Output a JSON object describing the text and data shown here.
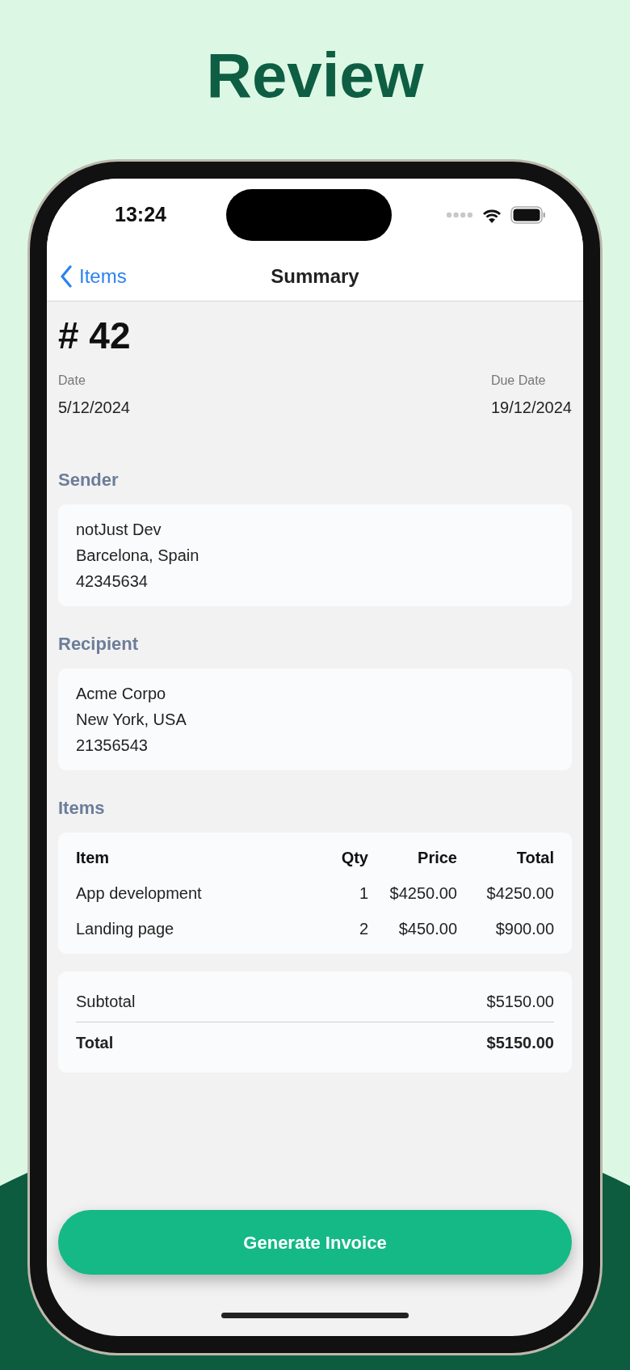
{
  "app_title": "Review",
  "status_bar": {
    "time": "13:24"
  },
  "nav": {
    "back": "Items",
    "title": "Summary"
  },
  "invoice": {
    "number": "# 42",
    "date_label": "Date",
    "date": "5/12/2024",
    "due_label": "Due Date",
    "due": "19/12/2024"
  },
  "parties": [
    {
      "heading": "Sender",
      "lines": [
        "notJust Dev",
        "Barcelona, Spain",
        "42345634"
      ]
    },
    {
      "heading": "Recipient",
      "lines": [
        "Acme Corpo",
        "New York, USA",
        "21356543"
      ]
    }
  ],
  "items": {
    "heading": "Items",
    "columns": [
      "Item",
      "Qty",
      "Price",
      "Total"
    ],
    "rows": [
      [
        "App development",
        "1",
        "$4250.00",
        "$4250.00"
      ],
      [
        "Landing page",
        "2",
        "$450.00",
        "$900.00"
      ]
    ]
  },
  "totals": [
    {
      "label": "Subtotal",
      "value": "$5150.00",
      "bold": false
    },
    {
      "label": "Total",
      "value": "$5150.00",
      "bold": true
    }
  ],
  "button": "Generate Invoice"
}
